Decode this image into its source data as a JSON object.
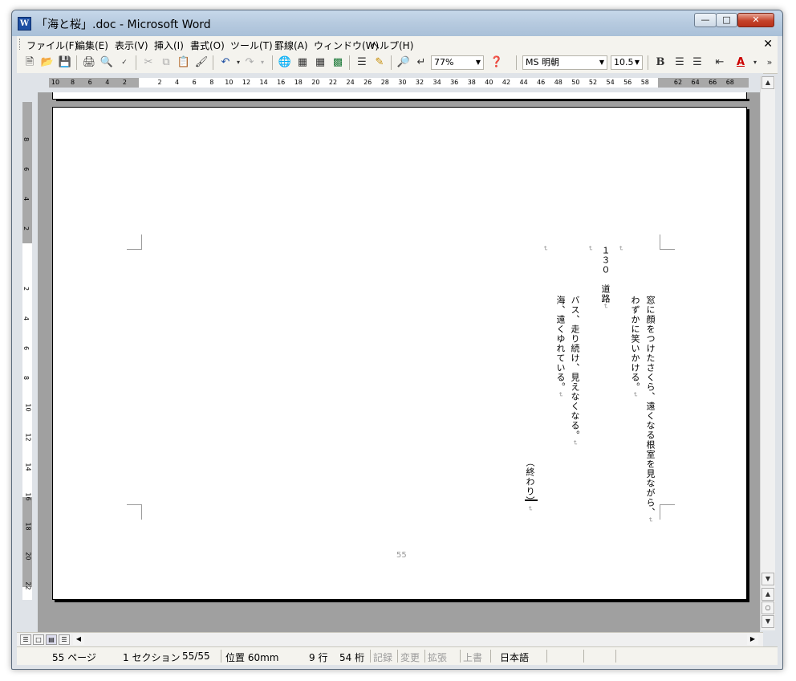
{
  "window": {
    "title": "「海と桜」.doc - Microsoft Word",
    "app_icon": "W"
  },
  "menubar": {
    "items": [
      "ファイル(F)",
      "編集(E)",
      "表示(V)",
      "挿入(I)",
      "書式(O)",
      "ツール(T)",
      "罫線(A)",
      "ウィンドウ(W)",
      "ヘルプ(H)"
    ]
  },
  "toolbar": {
    "zoom": "77%",
    "font_name": "MS 明朝",
    "font_size": "10.5",
    "bold_label": "B",
    "font_color_label": "A",
    "overflow": "»"
  },
  "ruler": {
    "h_left": [
      "10",
      "8",
      "6",
      "4",
      "2"
    ],
    "h_main": [
      "2",
      "4",
      "6",
      "8",
      "10",
      "12",
      "14",
      "16",
      "18",
      "20",
      "22",
      "24",
      "26",
      "28",
      "30",
      "32",
      "34",
      "36",
      "38",
      "40",
      "42",
      "44",
      "46",
      "48",
      "50",
      "52",
      "54",
      "56",
      "58"
    ],
    "h_right": [
      "62",
      "64",
      "66",
      "68"
    ],
    "v_top": [
      "8",
      "6",
      "4",
      "2"
    ],
    "v_main": [
      "2",
      "4",
      "6",
      "8",
      "10",
      "12",
      "14",
      "16"
    ],
    "v_bottom": [
      "18",
      "20",
      "22"
    ]
  },
  "document": {
    "columns": [
      "窓に顔をつけたさくら、遠くなる根室を見ながら、",
      "わずかに笑いかける。",
      "",
      "１３０　道路",
      "バス、走り続け、見えなくなる。",
      "海、遠くゆれている。",
      ""
    ],
    "ending": "（終わり）",
    "page_number": "55"
  },
  "statusbar": {
    "page": "55 ページ",
    "section": "1 セクション",
    "page_of": "55/55",
    "position": "位置 60mm",
    "line": "9 行",
    "column": "54 桁",
    "rec": "記録",
    "trk": "変更",
    "ext": "拡張",
    "ovr": "上書",
    "language": "日本語"
  },
  "colors": {
    "title_gradient": "#b6cadf",
    "close_button": "#c5432a",
    "canvas": "#a0a0a0",
    "ruler_margin": "#a8a8a8"
  }
}
